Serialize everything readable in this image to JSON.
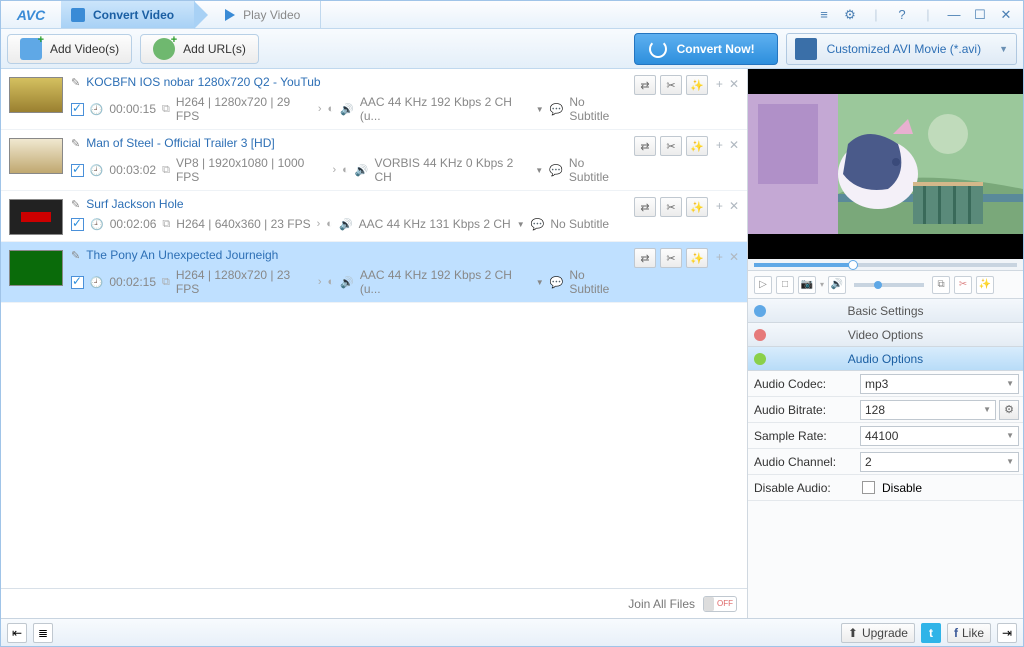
{
  "app": {
    "logo": "AVC"
  },
  "tabs": {
    "convert": "Convert Video",
    "play": "Play Video"
  },
  "toolbar": {
    "add_videos": "Add Video(s)",
    "add_urls": "Add URL(s)",
    "convert_now": "Convert Now!",
    "profile": "Customized AVI Movie (*.avi)"
  },
  "list": [
    {
      "title": "KOCBFN IOS nobar 1280x720 Q2 - YouTub",
      "dur": "00:00:15",
      "vmeta": "H264 | 1280x720 | 29 FPS",
      "ameta": "AAC 44 KHz 192 Kbps 2 CH (u...",
      "sub": "No Subtitle"
    },
    {
      "title": "Man of Steel - Official Trailer 3 [HD]",
      "dur": "00:03:02",
      "vmeta": "VP8 | 1920x1080 | 1000 FPS",
      "ameta": "VORBIS 44 KHz 0 Kbps 2 CH",
      "sub": "No Subtitle"
    },
    {
      "title": "Surf Jackson Hole",
      "dur": "00:02:06",
      "vmeta": "H264 | 640x360 | 23 FPS",
      "ameta": "AAC 44 KHz 131 Kbps 2 CH",
      "sub": "No Subtitle"
    },
    {
      "title": "The Pony An Unexpected Journeigh",
      "dur": "00:02:15",
      "vmeta": "H264 | 1280x720 | 23 FPS",
      "ameta": "AAC 44 KHz 192 Kbps 2 CH (u...",
      "sub": "No Subtitle"
    }
  ],
  "join": {
    "label": "Join All Files",
    "switch": "OFF"
  },
  "panels": {
    "basic": "Basic Settings",
    "video": "Video Options",
    "audio": "Audio Options"
  },
  "audio": {
    "codec_label": "Audio Codec:",
    "codec": "mp3",
    "bitrate_label": "Audio Bitrate:",
    "bitrate": "128",
    "sample_label": "Sample Rate:",
    "sample": "44100",
    "channel_label": "Audio Channel:",
    "channel": "2",
    "disable_label": "Disable Audio:",
    "disable": "Disable"
  },
  "status": {
    "upgrade": "Upgrade",
    "like": "Like"
  },
  "chart_data": null
}
